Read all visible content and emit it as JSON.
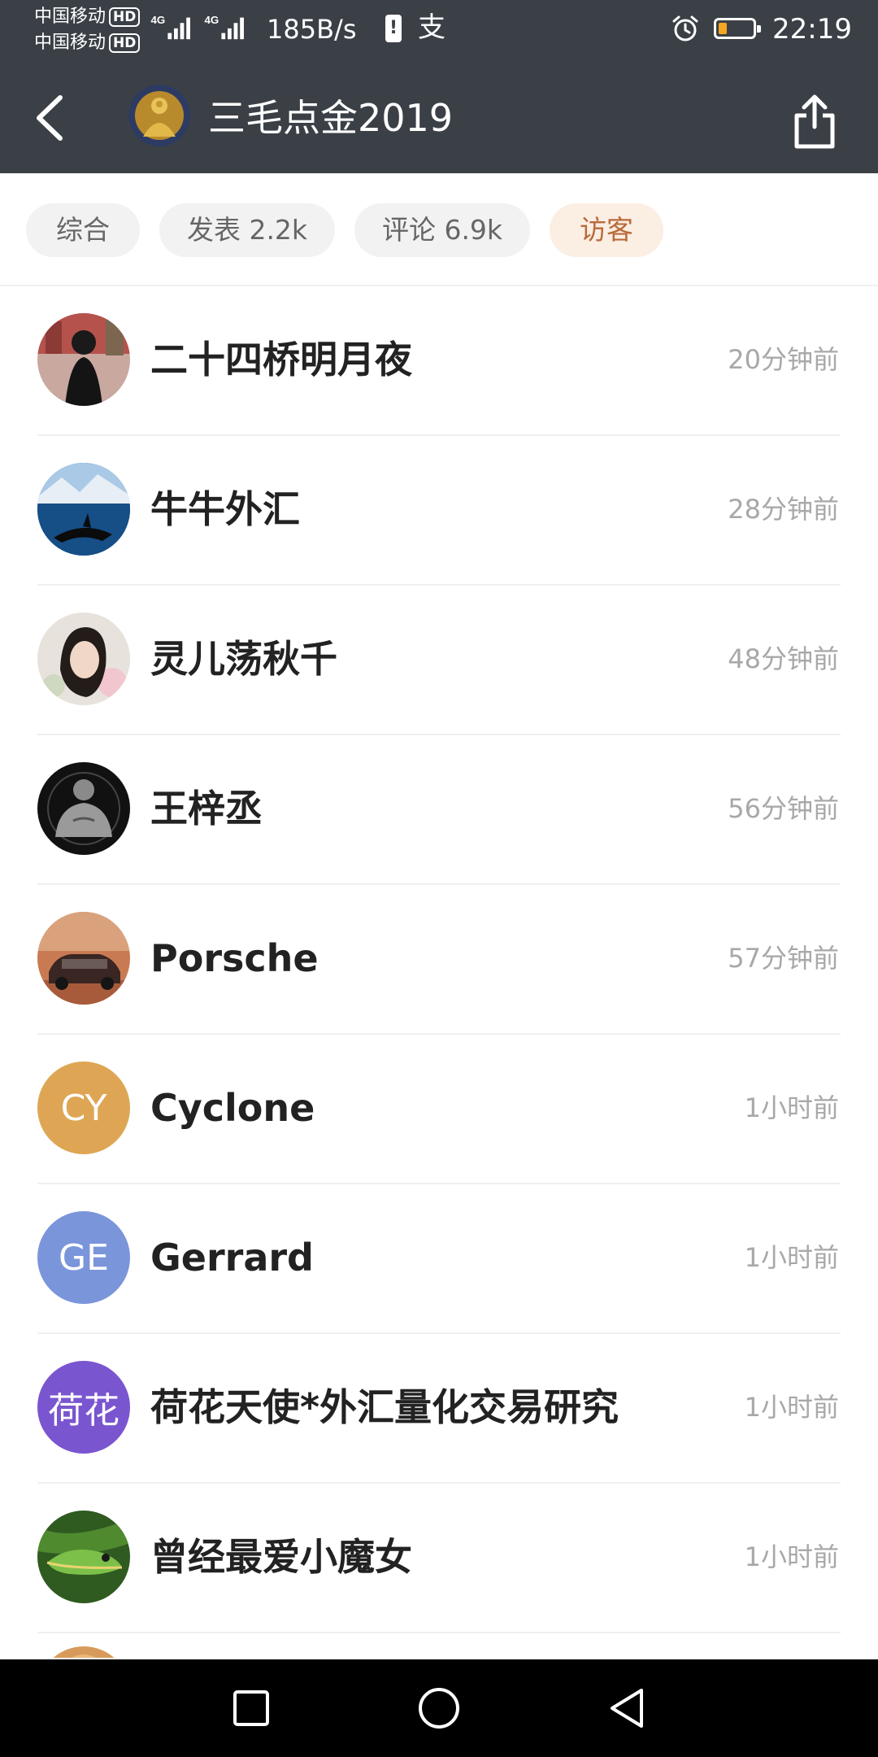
{
  "status_bar": {
    "carrier_1": "中国移动",
    "carrier_2": "中国移动",
    "hd_badge": "HD",
    "network_type_1": "4G",
    "network_type_2": "4G",
    "net_speed": "185B/s",
    "alipay_glyph": "支",
    "time": "22:19",
    "battery_level": 0.25,
    "battery_color": "#f5a623"
  },
  "header": {
    "title": "三毛点金2019",
    "back_icon": "chevron-left-icon",
    "share_icon": "share-icon"
  },
  "tabs": [
    {
      "label": "综合",
      "active": false
    },
    {
      "label": "发表 2.2k",
      "active": false
    },
    {
      "label": "评论 6.9k",
      "active": false
    },
    {
      "label": "访客",
      "active": true
    }
  ],
  "visitors": [
    {
      "name": "二十四桥明月夜",
      "time": "20分钟前",
      "avatar_type": "photo"
    },
    {
      "name": "牛牛外汇",
      "time": "28分钟前",
      "avatar_type": "photo"
    },
    {
      "name": "灵儿荡秋千",
      "time": "48分钟前",
      "avatar_type": "photo"
    },
    {
      "name": "王梓丞",
      "time": "56分钟前",
      "avatar_type": "photo"
    },
    {
      "name": "Porsche",
      "time": "57分钟前",
      "avatar_type": "photo"
    },
    {
      "name": "Cyclone",
      "time": "1小时前",
      "avatar_type": "initials",
      "initials": "CY",
      "avatar_color": "#dea654"
    },
    {
      "name": "Gerrard",
      "time": "1小时前",
      "avatar_type": "initials",
      "initials": "GE",
      "avatar_color": "#7b95db"
    },
    {
      "name": "荷花天使*外汇量化交易研究",
      "time": "1小时前",
      "avatar_type": "initials",
      "initials": "荷花",
      "avatar_color": "#7a55d0"
    },
    {
      "name": "曾经最爱小魔女",
      "time": "1小时前",
      "avatar_type": "photo"
    }
  ],
  "colors": {
    "header_bg": "#3b4047",
    "active_tab_bg": "#fbeee3",
    "active_tab_text": "#b96a3a",
    "time_text": "#a8a8a8"
  },
  "nav_bar": {
    "recents_icon": "square-icon",
    "home_icon": "circle-icon",
    "back_icon": "triangle-back-icon"
  }
}
